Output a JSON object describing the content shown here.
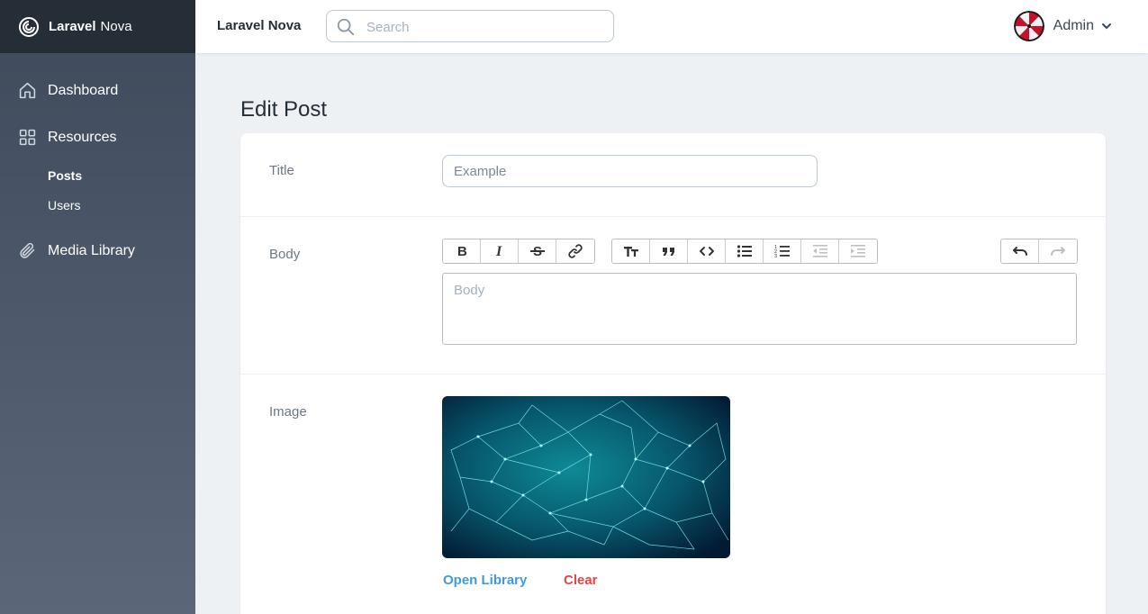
{
  "brand": {
    "name_bold": "Laravel",
    "name_regular": "Nova"
  },
  "sidebar": {
    "items": [
      {
        "label": "Dashboard",
        "icon": "home-icon"
      },
      {
        "label": "Resources",
        "icon": "grid-icon"
      },
      {
        "label": "Media Library",
        "icon": "paperclip-icon"
      }
    ],
    "resources": [
      {
        "label": "Posts",
        "active": true
      },
      {
        "label": "Users",
        "active": false
      }
    ]
  },
  "header": {
    "title": "Laravel Nova",
    "search_placeholder": "Search",
    "user_name": "Admin"
  },
  "page": {
    "title": "Edit Post"
  },
  "form": {
    "title_label": "Title",
    "title_placeholder": "Example",
    "body_label": "Body",
    "body_placeholder": "Body",
    "image_label": "Image",
    "open_library": "Open Library",
    "clear": "Clear"
  },
  "toolbar": {
    "group1": [
      "bold-icon",
      "italic-icon",
      "strikethrough-icon",
      "link-icon"
    ],
    "group2": [
      "heading-icon",
      "quote-icon",
      "code-icon",
      "bullet-list-icon",
      "numbered-list-icon",
      "outdent-icon",
      "indent-icon"
    ],
    "group3": [
      "undo-icon",
      "redo-icon"
    ]
  },
  "colors": {
    "sidebar_top": "#252d37",
    "sidebar_bg": "#4a5668",
    "link_blue": "#4099de",
    "danger_red": "#e74444"
  }
}
